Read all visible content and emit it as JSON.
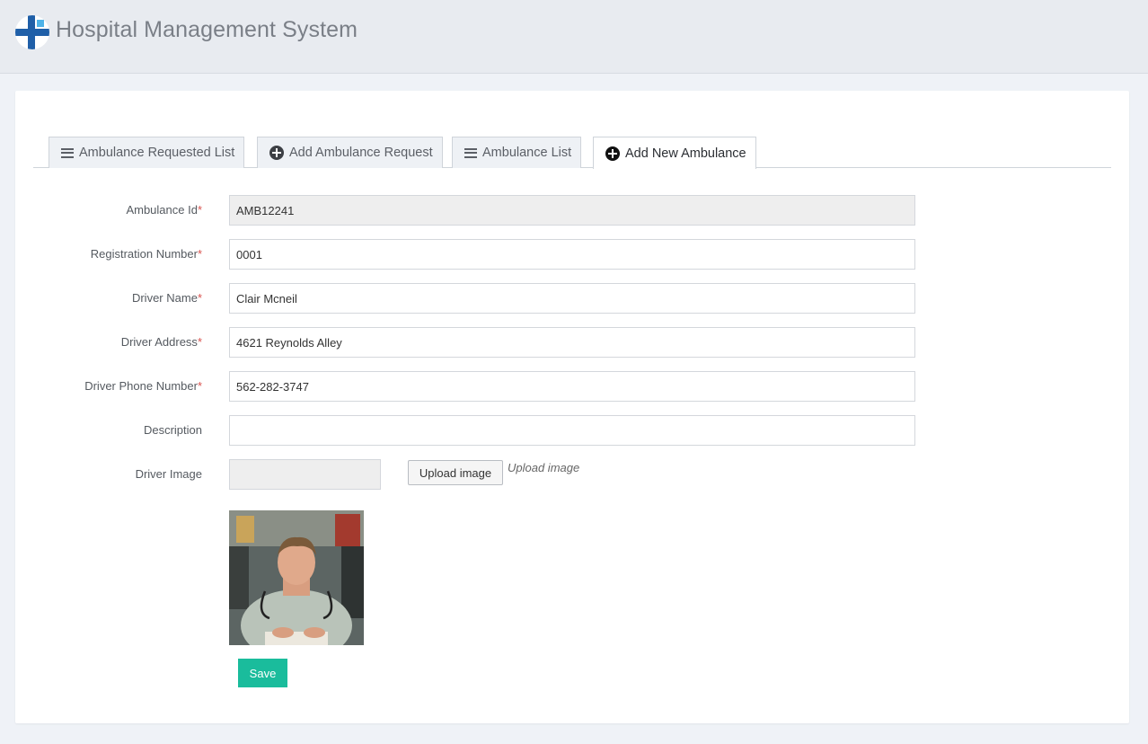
{
  "app": {
    "title": "Hospital Management System"
  },
  "tabs": [
    {
      "label": "Ambulance Requested List",
      "icon": "list-icon"
    },
    {
      "label": "Add Ambulance Request",
      "icon": "plus-circle-icon"
    },
    {
      "label": "Ambulance List",
      "icon": "list-icon"
    },
    {
      "label": "Add New Ambulance",
      "icon": "plus-circle-icon",
      "active": true
    }
  ],
  "form": {
    "ambulance_id": {
      "label": "Ambulance Id",
      "value": "AMB12241",
      "required": "*"
    },
    "registration_number": {
      "label": "Registration Number",
      "value": "0001",
      "required": "*"
    },
    "driver_name": {
      "label": "Driver Name",
      "value": "Clair Mcneil",
      "required": "*"
    },
    "driver_address": {
      "label": "Driver Address",
      "value": "4621 Reynolds Alley",
      "required": "*"
    },
    "driver_phone": {
      "label": "Driver Phone Number",
      "value": "562-282-3747",
      "required": "*"
    },
    "description": {
      "label": "Description",
      "value": ""
    },
    "driver_image": {
      "label": "Driver Image",
      "upload_label": "Upload image",
      "upload_hint": "Upload image"
    },
    "save_label": "Save"
  },
  "colors": {
    "accent": "#1abc9c",
    "required": "#d9534f",
    "brand_blue": "#1f5fa8"
  }
}
